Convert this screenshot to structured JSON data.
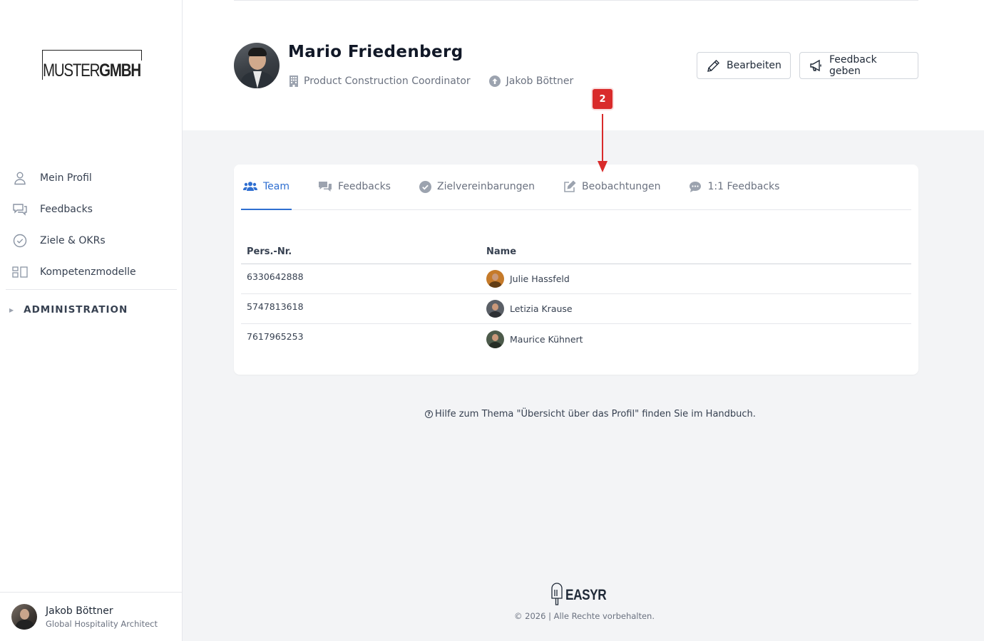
{
  "brand": {
    "logo_light": "MUSTER",
    "logo_bold": "GMBH"
  },
  "sidebar": {
    "items": [
      {
        "label": "Mein Profil",
        "icon": "user-icon"
      },
      {
        "label": "Feedbacks",
        "icon": "chat-bubbles-icon"
      },
      {
        "label": "Ziele & OKRs",
        "icon": "check-circle-icon"
      },
      {
        "label": "Kompetenzmodelle",
        "icon": "grid-blocks-icon"
      }
    ],
    "admin_label": "ADMINISTRATION",
    "user": {
      "name": "Jakob Böttner",
      "role": "Global Hospitality Architect"
    }
  },
  "profile": {
    "name": "Mario Friedenberg",
    "position": "Product Construction Coordinator",
    "manager": "Jakob Böttner",
    "edit_label": "Bearbeiten",
    "feedback_label": "Feedback geben"
  },
  "tabs": [
    {
      "label": "Team",
      "icon": "users-icon",
      "active": true
    },
    {
      "label": "Feedbacks",
      "icon": "comments-icon",
      "active": false
    },
    {
      "label": "Zielvereinbarungen",
      "icon": "check-circle-icon",
      "active": false
    },
    {
      "label": "Beobachtungen",
      "icon": "edit-icon",
      "active": false
    },
    {
      "label": "1:1 Feedbacks",
      "icon": "speech-bubble-icon",
      "active": false
    }
  ],
  "team_table": {
    "columns": [
      "Pers.-Nr.",
      "Name"
    ],
    "rows": [
      {
        "id": "6330642888",
        "name": "Julie Hassfeld"
      },
      {
        "id": "5747813618",
        "name": "Letizia Krause"
      },
      {
        "id": "7617965253",
        "name": "Maurice Kühnert"
      }
    ]
  },
  "help": {
    "text": "Hilfe zum Thema \"Übersicht über das Profil\" finden Sie im Handbuch."
  },
  "footer": {
    "logo_text": "EASYR",
    "copyright": "© 2026 | Alle Rechte vorbehalten."
  },
  "annotation": {
    "badge": "2",
    "color": "#d92b2b"
  },
  "colors": {
    "accent": "#2f6fd1",
    "background": "#f3f4f6"
  }
}
